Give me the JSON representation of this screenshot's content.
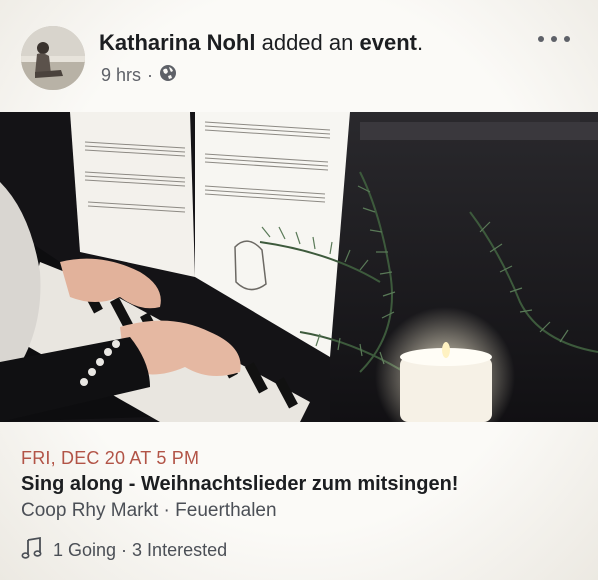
{
  "post": {
    "author": "Katharina Nohl",
    "action_text": "added an",
    "action_object": "event",
    "action_end": ".",
    "time": "9 hrs",
    "separator": "·",
    "audience_icon": "globe-icon",
    "more_icon": "more-horizontal-icon"
  },
  "photo": {
    "subject": "piano with sheet music, pine branches and candle"
  },
  "event": {
    "date": "FRI, DEC 20 AT 5 PM",
    "title": "Sing along - Weihnachtslieder zum mitsingen!",
    "location": "Coop Rhy Markt · Feuerthalen",
    "stats_icon": "music-note-icon",
    "stats": "1 Going · 3 Interested"
  },
  "colors": {
    "date_accent": "#b25447",
    "muted_text": "#5e6168",
    "primary_text": "#1c1e21"
  }
}
